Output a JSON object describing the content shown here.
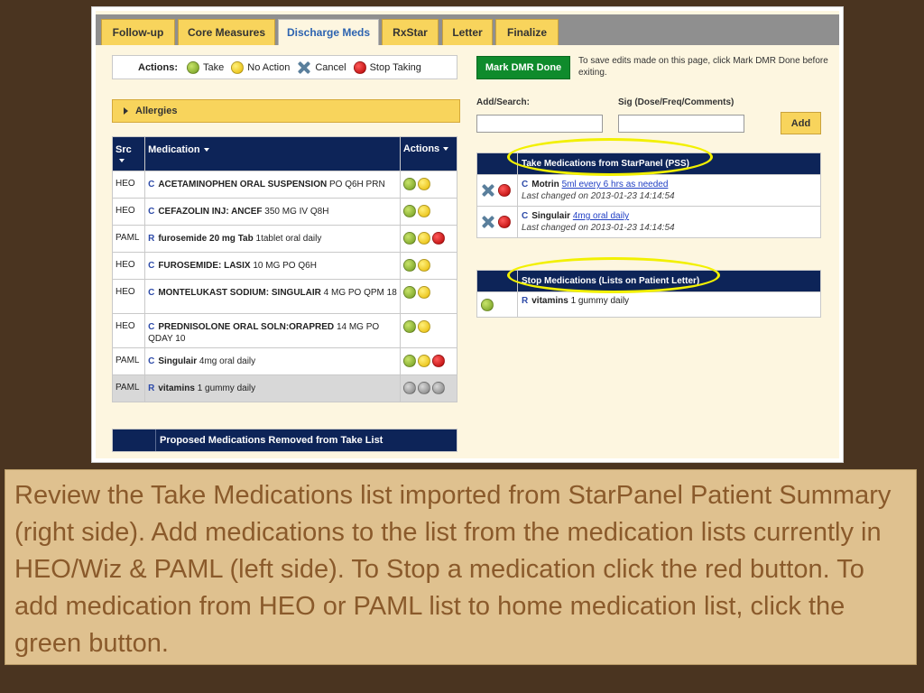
{
  "tabs": [
    "Follow-up",
    "Core Measures",
    "Discharge Meds",
    "RxStar",
    "Letter",
    "Finalize"
  ],
  "active_tab": "Discharge Meds",
  "legend": {
    "label": "Actions:",
    "items": [
      {
        "label": "Take",
        "icon": "green-circle-icon"
      },
      {
        "label": "No Action",
        "icon": "yellow-circle-icon"
      },
      {
        "label": "Cancel",
        "icon": "blue-x-icon"
      },
      {
        "label": "Stop Taking",
        "icon": "red-circle-icon"
      }
    ]
  },
  "allergies_label": "Allergies",
  "left_table": {
    "headers": {
      "src": "Src",
      "medication": "Medication",
      "actions": "Actions"
    },
    "rows": [
      {
        "src": "HEO",
        "type": "C",
        "name": "ACETAMINOPHEN ORAL SUSPENSION",
        "detail": "PO Q6H PRN",
        "actions": [
          "green",
          "yellow"
        ]
      },
      {
        "src": "HEO",
        "type": "C",
        "name": "CEFAZOLIN INJ: ANCEF",
        "detail": "350 MG IV Q8H",
        "actions": [
          "green",
          "yellow"
        ]
      },
      {
        "src": "PAML",
        "type": "R",
        "name": "furosemide 20 mg Tab",
        "detail": "1tablet oral daily",
        "actions": [
          "green",
          "yellow",
          "red"
        ]
      },
      {
        "src": "HEO",
        "type": "C",
        "name": "FUROSEMIDE: LASIX",
        "detail": "10 MG PO Q6H",
        "actions": [
          "green",
          "yellow"
        ]
      },
      {
        "src": "HEO",
        "type": "C",
        "name": "MONTELUKAST SODIUM: SINGULAIR",
        "detail": "4 MG PO QPM 18",
        "actions": [
          "green",
          "yellow"
        ]
      },
      {
        "src": "HEO",
        "type": "C",
        "name": "PREDNISOLONE ORAL SOLN:ORAPRED",
        "detail": "14 MG PO QDAY 10",
        "actions": [
          "green",
          "yellow"
        ]
      },
      {
        "src": "PAML",
        "type": "C",
        "name": "Singulair",
        "detail": "4mg oral daily",
        "actions": [
          "green",
          "yellow",
          "red"
        ]
      },
      {
        "src": "PAML",
        "type": "R",
        "name": "vitamins",
        "detail": "1 gummy daily",
        "actions": [
          "gray",
          "gray",
          "gray"
        ],
        "highlight": true
      }
    ]
  },
  "proposed_label": "Proposed Medications Removed from Take List",
  "mark_done_label": "Mark DMR Done",
  "save_note": "To save edits made on this page, click Mark DMR Done before exiting.",
  "add_search_label": "Add/Search:",
  "sig_label": "Sig (Dose/Freq/Comments)",
  "add_search_value": "",
  "sig_value": "",
  "add_button_label": "Add",
  "take_section": {
    "title": "Take Medications from StarPanel (PSS)",
    "rows": [
      {
        "type": "C",
        "name": "Motrin",
        "sig": "5ml every 6 hrs as needed",
        "changed": "Last changed on 2013-01-23 14:14:54"
      },
      {
        "type": "C",
        "name": "Singulair",
        "sig": "4mg oral daily",
        "changed": "Last changed on 2013-01-23 14:14:54"
      }
    ]
  },
  "stop_section": {
    "title": "Stop Medications (Lists on Patient Letter)",
    "rows": [
      {
        "type": "R",
        "name": "vitamins",
        "detail": "1 gummy daily"
      }
    ]
  },
  "caption": "Review the Take Medications list imported from StarPanel Patient Summary (right side). Add medications to the list from the medication lists currently in HEO/Wiz & PAML (left side). To Stop a medication click the red button. To add medication from HEO or PAML list to home medication list, click the green button.",
  "colors": {
    "navy": "#0d2458",
    "tab_yellow": "#f8d45c",
    "highlight_ring": "#f2f000",
    "brown_bg": "#4a3420",
    "caption_bg": "#dfc18f"
  }
}
